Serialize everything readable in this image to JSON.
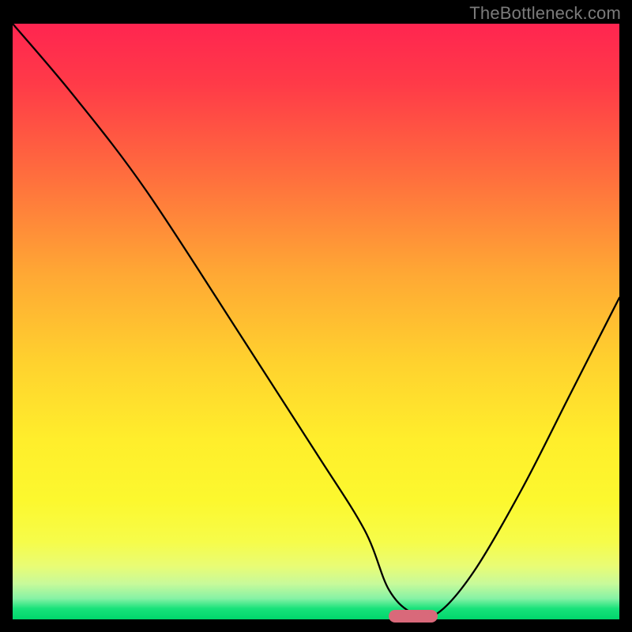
{
  "watermark": "TheBottleneck.com",
  "colors": {
    "frame": "#000000",
    "gradient_top": "#ff2550",
    "gradient_bottom": "#00d66c",
    "curve": "#000000",
    "marker": "#d9697a"
  },
  "chart_data": {
    "type": "line",
    "title": "",
    "xlabel": "",
    "ylabel": "",
    "xlim": [
      0,
      100
    ],
    "ylim": [
      0,
      100
    ],
    "grid": false,
    "legend": false,
    "series": [
      {
        "name": "curve",
        "x": [
          0,
          10,
          22,
          38,
          50,
          58,
          62,
          66,
          70,
          76,
          84,
          92,
          100
        ],
        "y": [
          100,
          88,
          72,
          47,
          28,
          15,
          5,
          1,
          1,
          8,
          22,
          38,
          54
        ]
      }
    ],
    "marker": {
      "x_start": 62,
      "x_end": 70,
      "y": 0.5
    }
  }
}
